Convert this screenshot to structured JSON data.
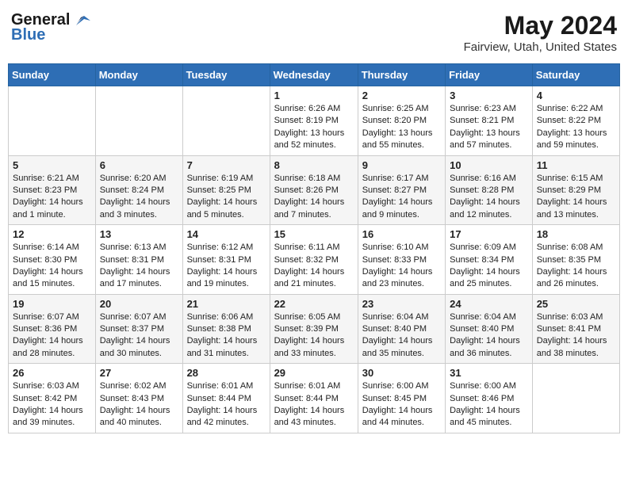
{
  "header": {
    "logo_general": "General",
    "logo_blue": "Blue",
    "month_title": "May 2024",
    "location": "Fairview, Utah, United States"
  },
  "weekdays": [
    "Sunday",
    "Monday",
    "Tuesday",
    "Wednesday",
    "Thursday",
    "Friday",
    "Saturday"
  ],
  "weeks": [
    [
      {
        "day": "",
        "sunrise": "",
        "sunset": "",
        "daylight": ""
      },
      {
        "day": "",
        "sunrise": "",
        "sunset": "",
        "daylight": ""
      },
      {
        "day": "",
        "sunrise": "",
        "sunset": "",
        "daylight": ""
      },
      {
        "day": "1",
        "sunrise": "Sunrise: 6:26 AM",
        "sunset": "Sunset: 8:19 PM",
        "daylight": "Daylight: 13 hours and 52 minutes."
      },
      {
        "day": "2",
        "sunrise": "Sunrise: 6:25 AM",
        "sunset": "Sunset: 8:20 PM",
        "daylight": "Daylight: 13 hours and 55 minutes."
      },
      {
        "day": "3",
        "sunrise": "Sunrise: 6:23 AM",
        "sunset": "Sunset: 8:21 PM",
        "daylight": "Daylight: 13 hours and 57 minutes."
      },
      {
        "day": "4",
        "sunrise": "Sunrise: 6:22 AM",
        "sunset": "Sunset: 8:22 PM",
        "daylight": "Daylight: 13 hours and 59 minutes."
      }
    ],
    [
      {
        "day": "5",
        "sunrise": "Sunrise: 6:21 AM",
        "sunset": "Sunset: 8:23 PM",
        "daylight": "Daylight: 14 hours and 1 minute."
      },
      {
        "day": "6",
        "sunrise": "Sunrise: 6:20 AM",
        "sunset": "Sunset: 8:24 PM",
        "daylight": "Daylight: 14 hours and 3 minutes."
      },
      {
        "day": "7",
        "sunrise": "Sunrise: 6:19 AM",
        "sunset": "Sunset: 8:25 PM",
        "daylight": "Daylight: 14 hours and 5 minutes."
      },
      {
        "day": "8",
        "sunrise": "Sunrise: 6:18 AM",
        "sunset": "Sunset: 8:26 PM",
        "daylight": "Daylight: 14 hours and 7 minutes."
      },
      {
        "day": "9",
        "sunrise": "Sunrise: 6:17 AM",
        "sunset": "Sunset: 8:27 PM",
        "daylight": "Daylight: 14 hours and 9 minutes."
      },
      {
        "day": "10",
        "sunrise": "Sunrise: 6:16 AM",
        "sunset": "Sunset: 8:28 PM",
        "daylight": "Daylight: 14 hours and 12 minutes."
      },
      {
        "day": "11",
        "sunrise": "Sunrise: 6:15 AM",
        "sunset": "Sunset: 8:29 PM",
        "daylight": "Daylight: 14 hours and 13 minutes."
      }
    ],
    [
      {
        "day": "12",
        "sunrise": "Sunrise: 6:14 AM",
        "sunset": "Sunset: 8:30 PM",
        "daylight": "Daylight: 14 hours and 15 minutes."
      },
      {
        "day": "13",
        "sunrise": "Sunrise: 6:13 AM",
        "sunset": "Sunset: 8:31 PM",
        "daylight": "Daylight: 14 hours and 17 minutes."
      },
      {
        "day": "14",
        "sunrise": "Sunrise: 6:12 AM",
        "sunset": "Sunset: 8:31 PM",
        "daylight": "Daylight: 14 hours and 19 minutes."
      },
      {
        "day": "15",
        "sunrise": "Sunrise: 6:11 AM",
        "sunset": "Sunset: 8:32 PM",
        "daylight": "Daylight: 14 hours and 21 minutes."
      },
      {
        "day": "16",
        "sunrise": "Sunrise: 6:10 AM",
        "sunset": "Sunset: 8:33 PM",
        "daylight": "Daylight: 14 hours and 23 minutes."
      },
      {
        "day": "17",
        "sunrise": "Sunrise: 6:09 AM",
        "sunset": "Sunset: 8:34 PM",
        "daylight": "Daylight: 14 hours and 25 minutes."
      },
      {
        "day": "18",
        "sunrise": "Sunrise: 6:08 AM",
        "sunset": "Sunset: 8:35 PM",
        "daylight": "Daylight: 14 hours and 26 minutes."
      }
    ],
    [
      {
        "day": "19",
        "sunrise": "Sunrise: 6:07 AM",
        "sunset": "Sunset: 8:36 PM",
        "daylight": "Daylight: 14 hours and 28 minutes."
      },
      {
        "day": "20",
        "sunrise": "Sunrise: 6:07 AM",
        "sunset": "Sunset: 8:37 PM",
        "daylight": "Daylight: 14 hours and 30 minutes."
      },
      {
        "day": "21",
        "sunrise": "Sunrise: 6:06 AM",
        "sunset": "Sunset: 8:38 PM",
        "daylight": "Daylight: 14 hours and 31 minutes."
      },
      {
        "day": "22",
        "sunrise": "Sunrise: 6:05 AM",
        "sunset": "Sunset: 8:39 PM",
        "daylight": "Daylight: 14 hours and 33 minutes."
      },
      {
        "day": "23",
        "sunrise": "Sunrise: 6:04 AM",
        "sunset": "Sunset: 8:40 PM",
        "daylight": "Daylight: 14 hours and 35 minutes."
      },
      {
        "day": "24",
        "sunrise": "Sunrise: 6:04 AM",
        "sunset": "Sunset: 8:40 PM",
        "daylight": "Daylight: 14 hours and 36 minutes."
      },
      {
        "day": "25",
        "sunrise": "Sunrise: 6:03 AM",
        "sunset": "Sunset: 8:41 PM",
        "daylight": "Daylight: 14 hours and 38 minutes."
      }
    ],
    [
      {
        "day": "26",
        "sunrise": "Sunrise: 6:03 AM",
        "sunset": "Sunset: 8:42 PM",
        "daylight": "Daylight: 14 hours and 39 minutes."
      },
      {
        "day": "27",
        "sunrise": "Sunrise: 6:02 AM",
        "sunset": "Sunset: 8:43 PM",
        "daylight": "Daylight: 14 hours and 40 minutes."
      },
      {
        "day": "28",
        "sunrise": "Sunrise: 6:01 AM",
        "sunset": "Sunset: 8:44 PM",
        "daylight": "Daylight: 14 hours and 42 minutes."
      },
      {
        "day": "29",
        "sunrise": "Sunrise: 6:01 AM",
        "sunset": "Sunset: 8:44 PM",
        "daylight": "Daylight: 14 hours and 43 minutes."
      },
      {
        "day": "30",
        "sunrise": "Sunrise: 6:00 AM",
        "sunset": "Sunset: 8:45 PM",
        "daylight": "Daylight: 14 hours and 44 minutes."
      },
      {
        "day": "31",
        "sunrise": "Sunrise: 6:00 AM",
        "sunset": "Sunset: 8:46 PM",
        "daylight": "Daylight: 14 hours and 45 minutes."
      },
      {
        "day": "",
        "sunrise": "",
        "sunset": "",
        "daylight": ""
      }
    ]
  ]
}
